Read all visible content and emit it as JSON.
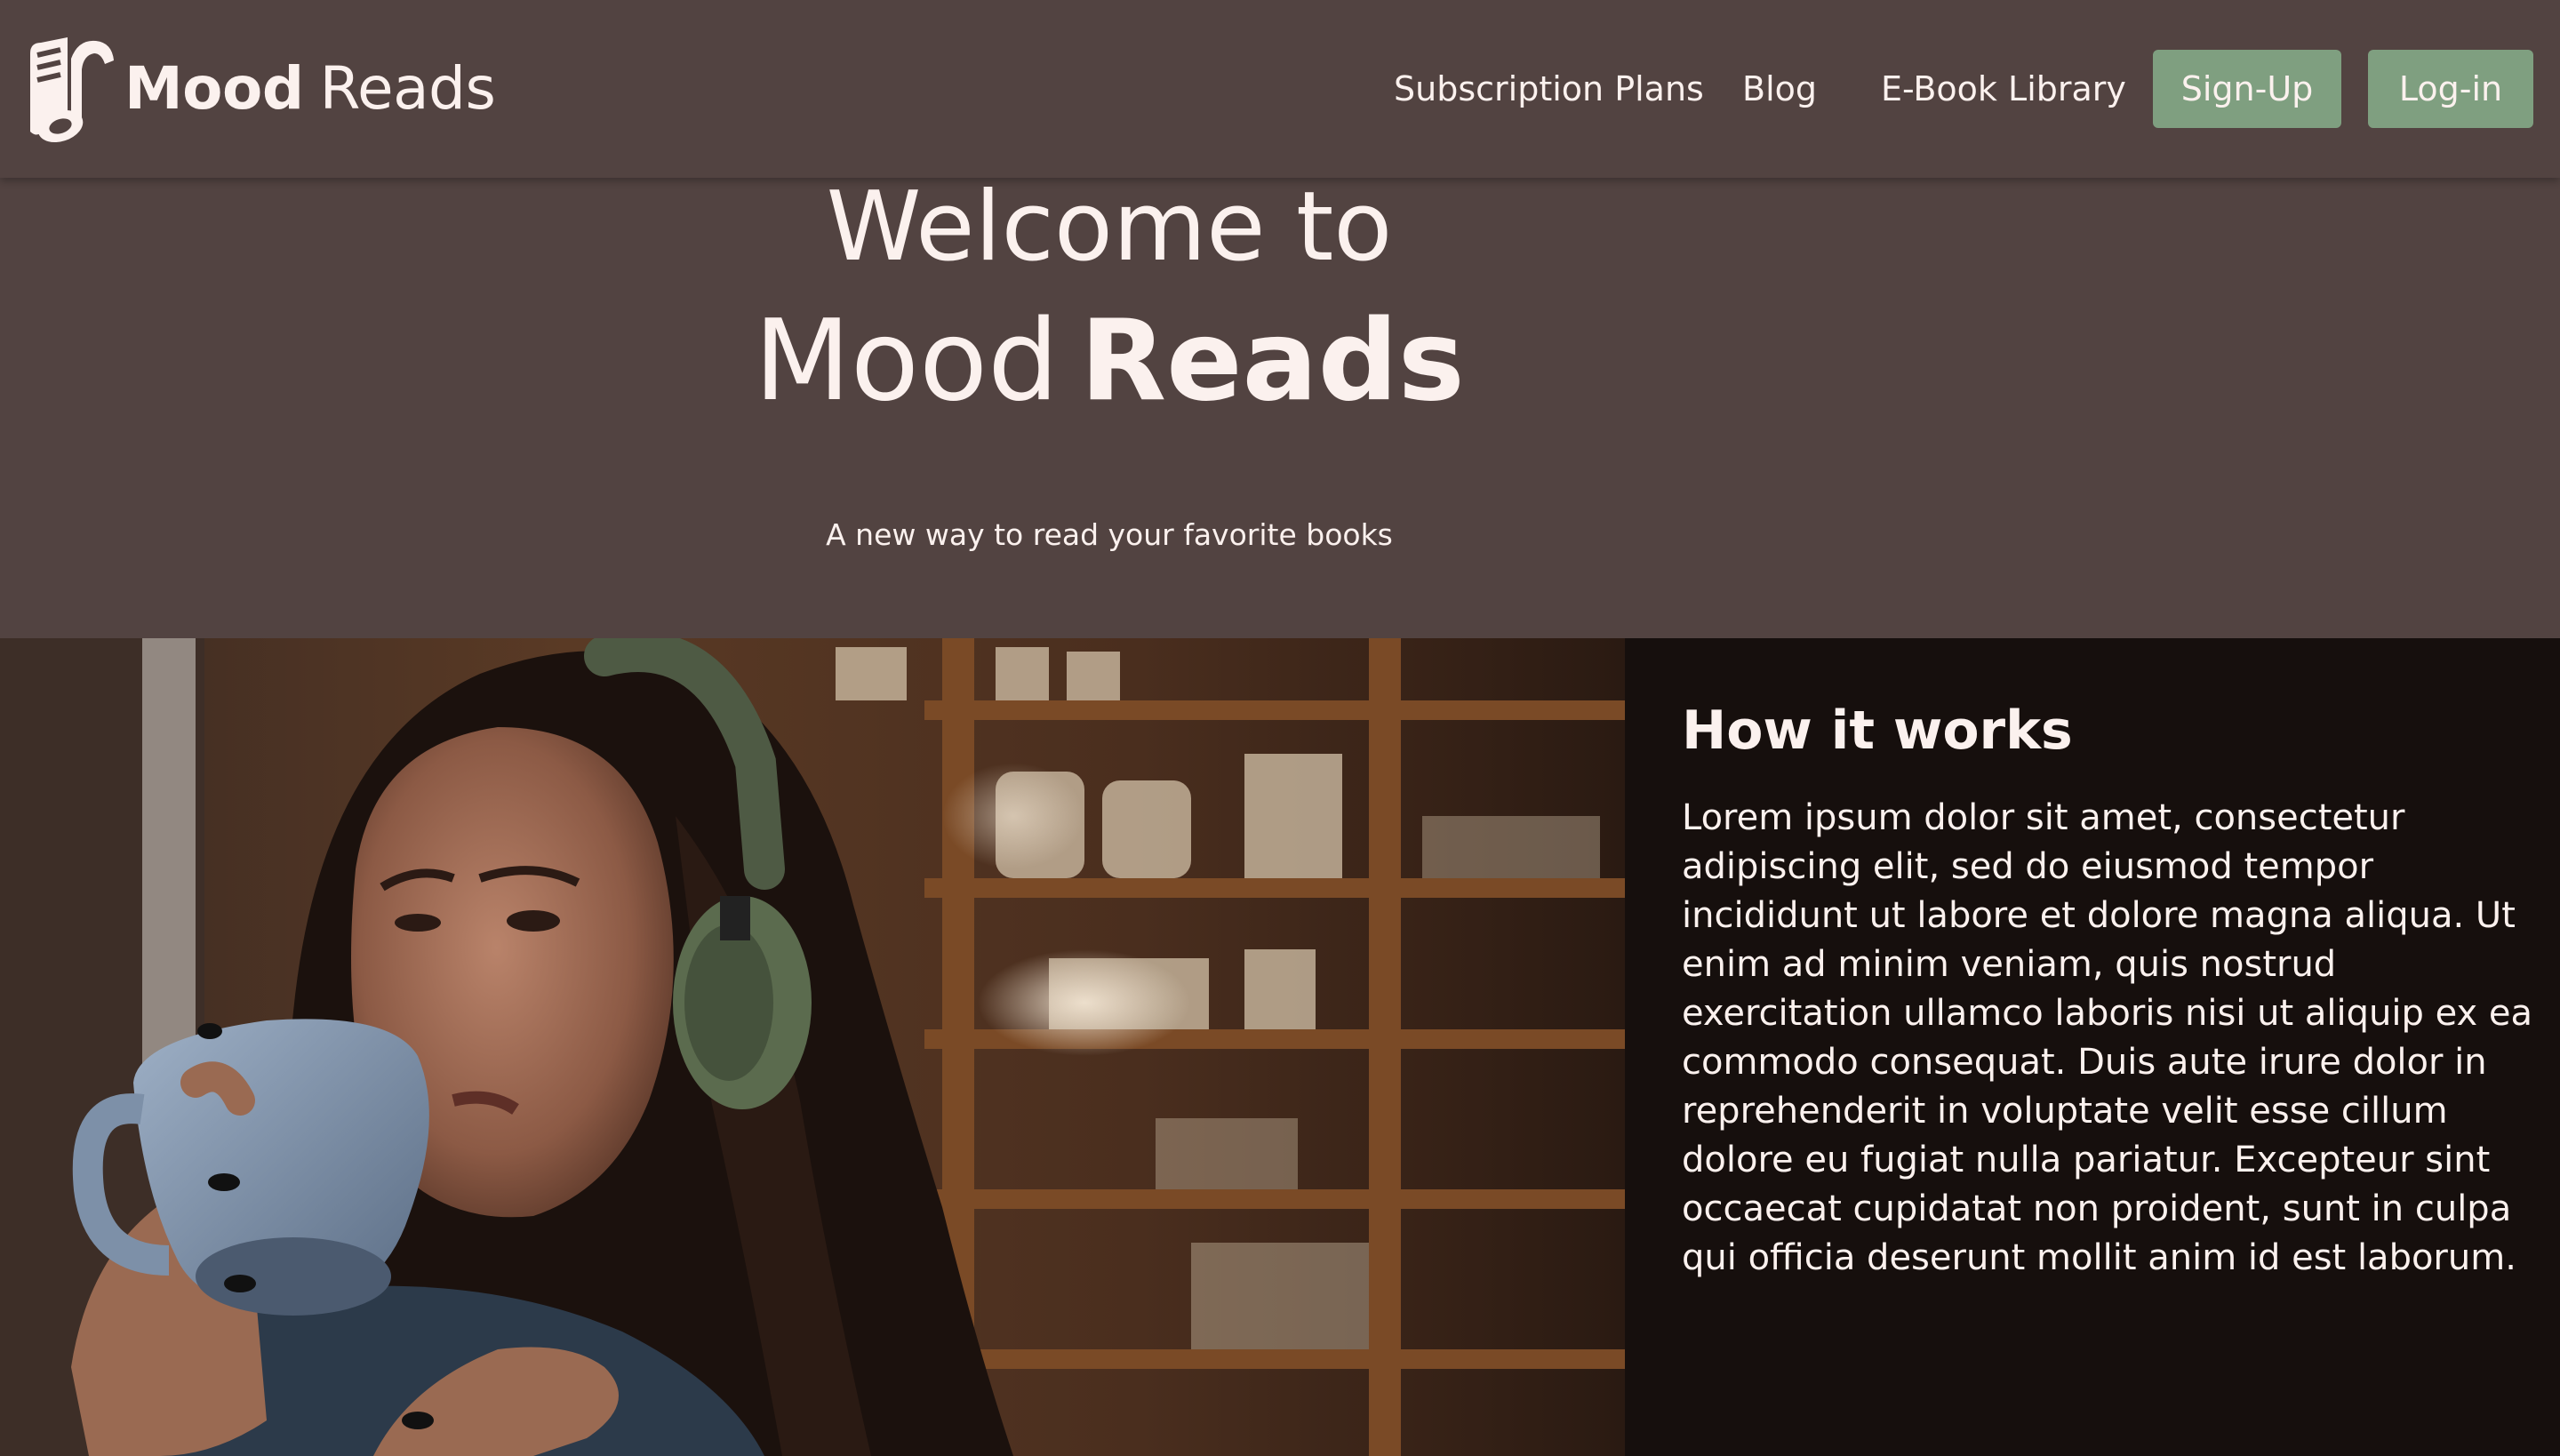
{
  "navbar": {
    "brand": {
      "name_bold": "Mood",
      "name_regular": "Reads",
      "logo_icon": "music-note-book-icon"
    },
    "links": [
      {
        "label": "Subscription Plans"
      },
      {
        "label": "Blog"
      },
      {
        "label": "E-Book Library"
      }
    ],
    "buttons": {
      "signup_label": "Sign-Up",
      "login_label": "Log-in"
    }
  },
  "hero": {
    "line1": "Welcome to",
    "line2_regular": "Mood",
    "line2_bold": "Reads",
    "tagline": "A new way to read your favorite books"
  },
  "how_it_works": {
    "title": "How it works",
    "body": "Lorem ipsum dolor sit amet, consectetur adipiscing elit, sed do eiusmod tempor incididunt ut labore et dolore magna aliqua. Ut enim ad minim veniam, quis nostrud exercitation ullamco laboris nisi ut aliquip ex ea commodo consequat. Duis aute irure dolor in reprehenderit in voluptate velit esse cillum dolore eu fugiat nulla pariatur. Excepteur sint occaecat cupidatat non proident, sunt in culpa qui officia deserunt mollit anim id est laborum."
  },
  "colors": {
    "background": "#524341",
    "text": "#fbf1ee",
    "button": "#7f9f80",
    "panel": "#160f0d"
  }
}
